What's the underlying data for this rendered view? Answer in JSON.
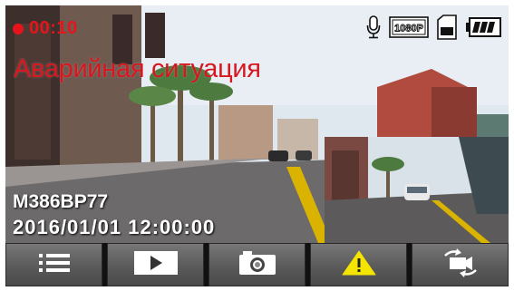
{
  "hud": {
    "recording_time": "00:10",
    "resolution_badge": "1080P",
    "icons": [
      "microphone-icon",
      "resolution-icon",
      "sd-card-icon",
      "battery-icon"
    ]
  },
  "alert": {
    "emergency_text": "Аварийная ситуация"
  },
  "overlay": {
    "plate": "M386BP77",
    "datetime": "2016/01/01  12:00:00"
  },
  "toolbar": {
    "buttons": [
      {
        "icon": "menu-icon"
      },
      {
        "icon": "play-icon"
      },
      {
        "icon": "camera-icon"
      },
      {
        "icon": "warning-icon"
      },
      {
        "icon": "switch-camera-icon"
      }
    ]
  },
  "colors": {
    "record_red": "#e8141b",
    "warning_yellow": "#f5e400",
    "toolbar_gray": "#5f5f5f"
  }
}
